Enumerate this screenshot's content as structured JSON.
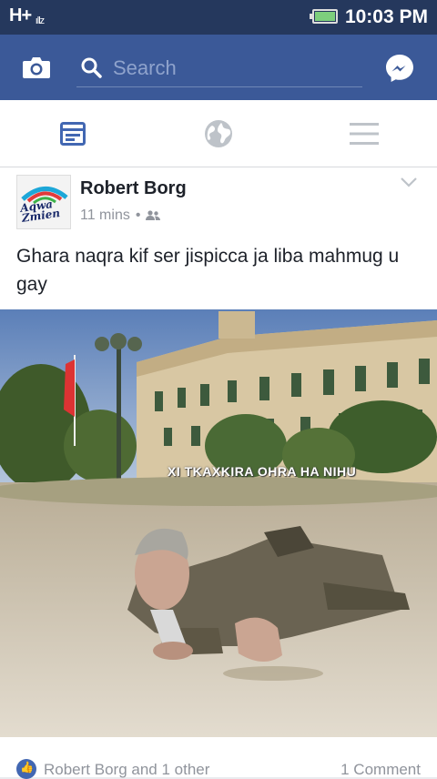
{
  "status_bar": {
    "signal_text": "H+",
    "signal_small": "ıllz",
    "time": "10:03 PM"
  },
  "app_bar": {
    "search_placeholder": "Search",
    "icons": [
      "camera-icon",
      "search-icon",
      "messenger-icon"
    ]
  },
  "tabs": [
    {
      "name": "news-feed",
      "icon": "news-feed-icon",
      "active": true
    },
    {
      "name": "notifications",
      "icon": "globe-icon",
      "active": false
    },
    {
      "name": "menu",
      "icon": "hamburger-menu-icon",
      "active": false
    }
  ],
  "post": {
    "avatar_text": "Aqwa Zmien",
    "author": "Robert Borg",
    "time": "11 mins",
    "separator": "•",
    "privacy_icon": "friends-icon",
    "text": "Ghara naqra kif ser jispicca ja liba mahmug u gay",
    "image_caption": "XI TKAXKIRA OHRA HA NIHU",
    "likes": "Robert Borg and 1 other",
    "comments": "1 Comment"
  },
  "colors": {
    "brand": "#3b5998",
    "status_bar": "#25385d",
    "active_tab": "#4267b2",
    "inactive_tab": "#bec3c9"
  }
}
